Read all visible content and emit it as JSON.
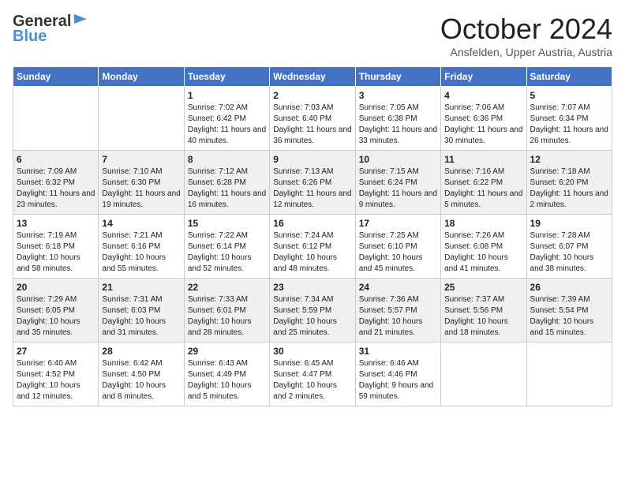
{
  "header": {
    "logo_general": "General",
    "logo_blue": "Blue",
    "month": "October 2024",
    "location": "Ansfelden, Upper Austria, Austria"
  },
  "weekdays": [
    "Sunday",
    "Monday",
    "Tuesday",
    "Wednesday",
    "Thursday",
    "Friday",
    "Saturday"
  ],
  "weeks": [
    [
      {
        "day": "",
        "info": ""
      },
      {
        "day": "",
        "info": ""
      },
      {
        "day": "1",
        "info": "Sunrise: 7:02 AM\nSunset: 6:42 PM\nDaylight: 11 hours and 40 minutes."
      },
      {
        "day": "2",
        "info": "Sunrise: 7:03 AM\nSunset: 6:40 PM\nDaylight: 11 hours and 36 minutes."
      },
      {
        "day": "3",
        "info": "Sunrise: 7:05 AM\nSunset: 6:38 PM\nDaylight: 11 hours and 33 minutes."
      },
      {
        "day": "4",
        "info": "Sunrise: 7:06 AM\nSunset: 6:36 PM\nDaylight: 11 hours and 30 minutes."
      },
      {
        "day": "5",
        "info": "Sunrise: 7:07 AM\nSunset: 6:34 PM\nDaylight: 11 hours and 26 minutes."
      }
    ],
    [
      {
        "day": "6",
        "info": "Sunrise: 7:09 AM\nSunset: 6:32 PM\nDaylight: 11 hours and 23 minutes."
      },
      {
        "day": "7",
        "info": "Sunrise: 7:10 AM\nSunset: 6:30 PM\nDaylight: 11 hours and 19 minutes."
      },
      {
        "day": "8",
        "info": "Sunrise: 7:12 AM\nSunset: 6:28 PM\nDaylight: 11 hours and 16 minutes."
      },
      {
        "day": "9",
        "info": "Sunrise: 7:13 AM\nSunset: 6:26 PM\nDaylight: 11 hours and 12 minutes."
      },
      {
        "day": "10",
        "info": "Sunrise: 7:15 AM\nSunset: 6:24 PM\nDaylight: 11 hours and 9 minutes."
      },
      {
        "day": "11",
        "info": "Sunrise: 7:16 AM\nSunset: 6:22 PM\nDaylight: 11 hours and 5 minutes."
      },
      {
        "day": "12",
        "info": "Sunrise: 7:18 AM\nSunset: 6:20 PM\nDaylight: 11 hours and 2 minutes."
      }
    ],
    [
      {
        "day": "13",
        "info": "Sunrise: 7:19 AM\nSunset: 6:18 PM\nDaylight: 10 hours and 58 minutes."
      },
      {
        "day": "14",
        "info": "Sunrise: 7:21 AM\nSunset: 6:16 PM\nDaylight: 10 hours and 55 minutes."
      },
      {
        "day": "15",
        "info": "Sunrise: 7:22 AM\nSunset: 6:14 PM\nDaylight: 10 hours and 52 minutes."
      },
      {
        "day": "16",
        "info": "Sunrise: 7:24 AM\nSunset: 6:12 PM\nDaylight: 10 hours and 48 minutes."
      },
      {
        "day": "17",
        "info": "Sunrise: 7:25 AM\nSunset: 6:10 PM\nDaylight: 10 hours and 45 minutes."
      },
      {
        "day": "18",
        "info": "Sunrise: 7:26 AM\nSunset: 6:08 PM\nDaylight: 10 hours and 41 minutes."
      },
      {
        "day": "19",
        "info": "Sunrise: 7:28 AM\nSunset: 6:07 PM\nDaylight: 10 hours and 38 minutes."
      }
    ],
    [
      {
        "day": "20",
        "info": "Sunrise: 7:29 AM\nSunset: 6:05 PM\nDaylight: 10 hours and 35 minutes."
      },
      {
        "day": "21",
        "info": "Sunrise: 7:31 AM\nSunset: 6:03 PM\nDaylight: 10 hours and 31 minutes."
      },
      {
        "day": "22",
        "info": "Sunrise: 7:33 AM\nSunset: 6:01 PM\nDaylight: 10 hours and 28 minutes."
      },
      {
        "day": "23",
        "info": "Sunrise: 7:34 AM\nSunset: 5:59 PM\nDaylight: 10 hours and 25 minutes."
      },
      {
        "day": "24",
        "info": "Sunrise: 7:36 AM\nSunset: 5:57 PM\nDaylight: 10 hours and 21 minutes."
      },
      {
        "day": "25",
        "info": "Sunrise: 7:37 AM\nSunset: 5:56 PM\nDaylight: 10 hours and 18 minutes."
      },
      {
        "day": "26",
        "info": "Sunrise: 7:39 AM\nSunset: 5:54 PM\nDaylight: 10 hours and 15 minutes."
      }
    ],
    [
      {
        "day": "27",
        "info": "Sunrise: 6:40 AM\nSunset: 4:52 PM\nDaylight: 10 hours and 12 minutes."
      },
      {
        "day": "28",
        "info": "Sunrise: 6:42 AM\nSunset: 4:50 PM\nDaylight: 10 hours and 8 minutes."
      },
      {
        "day": "29",
        "info": "Sunrise: 6:43 AM\nSunset: 4:49 PM\nDaylight: 10 hours and 5 minutes."
      },
      {
        "day": "30",
        "info": "Sunrise: 6:45 AM\nSunset: 4:47 PM\nDaylight: 10 hours and 2 minutes."
      },
      {
        "day": "31",
        "info": "Sunrise: 6:46 AM\nSunset: 4:46 PM\nDaylight: 9 hours and 59 minutes."
      },
      {
        "day": "",
        "info": ""
      },
      {
        "day": "",
        "info": ""
      }
    ]
  ]
}
